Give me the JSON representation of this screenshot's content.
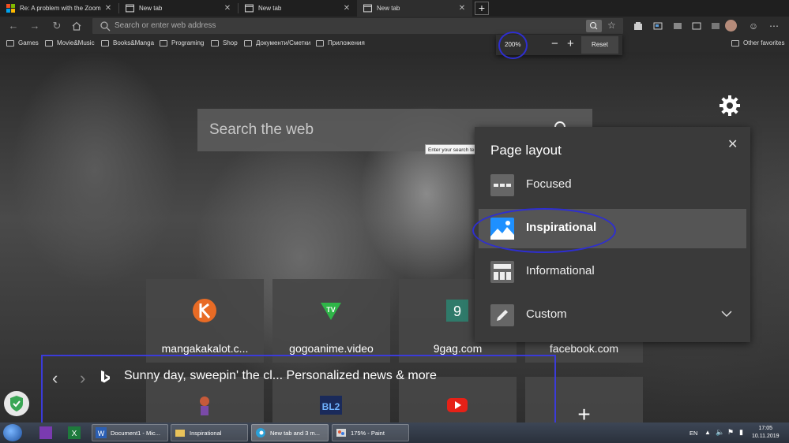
{
  "tabs": [
    {
      "title": "Re: A problem with the Zoom le",
      "active": false
    },
    {
      "title": "New tab",
      "active": false
    },
    {
      "title": "New tab",
      "active": false
    },
    {
      "title": "New tab",
      "active": true
    }
  ],
  "address": {
    "placeholder": "Search or enter web address"
  },
  "favorites": [
    "Games",
    "Movie&Music",
    "Books&Manga",
    "Programing",
    "Shop",
    "Документи/Сметки",
    "Приложения"
  ],
  "other_favorites": "Other favorites",
  "zoom": {
    "level": "200%",
    "minus": "−",
    "plus": "+",
    "reset": "Reset"
  },
  "search": {
    "placeholder": "Search the web",
    "tooltip": "Enter your search term"
  },
  "tiles": [
    {
      "label": "mangakakalot.c...",
      "icon": "mangakakalot-logo"
    },
    {
      "label": "gogoanime.video",
      "icon": "gogoanime-logo"
    },
    {
      "label": "9gag.com",
      "icon": "9gag-logo"
    },
    {
      "label": "facebook.com",
      "icon": "facebook-logo"
    },
    {
      "label": "",
      "icon": "anime-character-logo"
    },
    {
      "label": "",
      "icon": "blizzard-logo"
    },
    {
      "label": "",
      "icon": "youtube-logo"
    },
    {
      "label": "+",
      "icon": "add-tile"
    }
  ],
  "news": {
    "headline": "Sunny day, sweepin' the cl... Personalized news & more"
  },
  "layout_panel": {
    "title": "Page layout",
    "options": [
      {
        "label": "Focused",
        "selected": false
      },
      {
        "label": "Inspirational",
        "selected": true
      },
      {
        "label": "Informational",
        "selected": false
      },
      {
        "label": "Custom",
        "selected": false
      }
    ]
  },
  "taskbar": {
    "buttons": [
      "Document1 - Mic...",
      "Inspirational",
      "New tab and 3 m...",
      "175% - Paint"
    ],
    "lang": "EN",
    "time": "17:05",
    "date": "10.11.2019"
  },
  "colors": {
    "annotation": "#2e2ed0",
    "accent": "#1e90ff"
  }
}
